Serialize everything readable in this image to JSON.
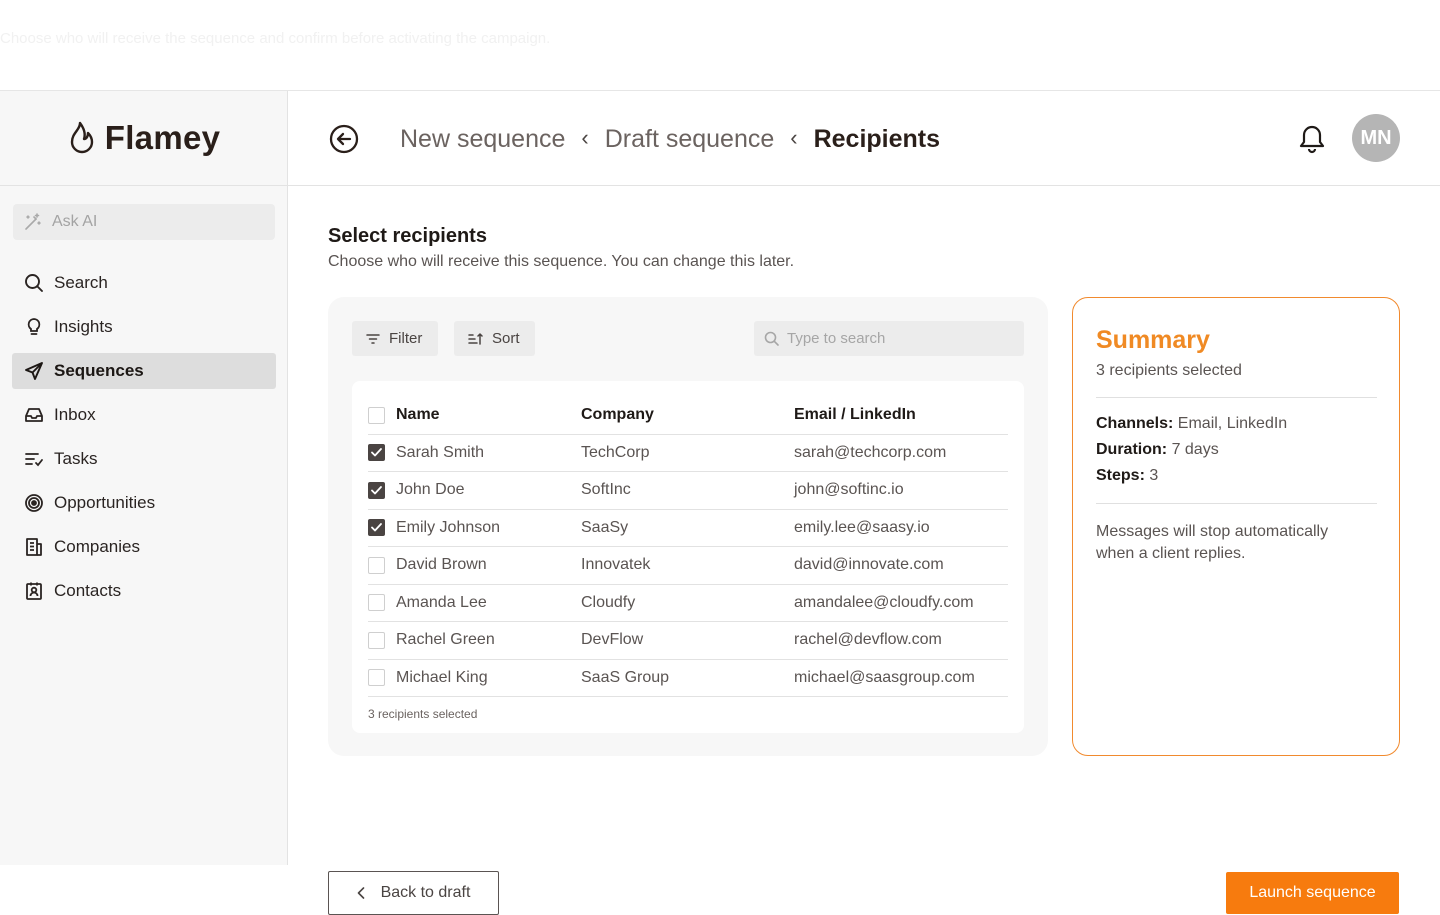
{
  "ghost_hint": "Choose who will receive the sequence and confirm before activating the campaign.",
  "brand": {
    "name": "Flamey",
    "icon": "flame-icon"
  },
  "sidebar": {
    "ask_ai": "Ask AI",
    "items": [
      {
        "label": "Search",
        "icon": "search-icon",
        "active": false
      },
      {
        "label": "Insights",
        "icon": "lightbulb-icon",
        "active": false
      },
      {
        "label": "Sequences",
        "icon": "send-icon",
        "active": true
      },
      {
        "label": "Inbox",
        "icon": "inbox-icon",
        "active": false
      },
      {
        "label": "Tasks",
        "icon": "tasks-icon",
        "active": false
      },
      {
        "label": "Opportunities",
        "icon": "target-icon",
        "active": false
      },
      {
        "label": "Companies",
        "icon": "building-icon",
        "active": false
      },
      {
        "label": "Contacts",
        "icon": "contact-card-icon",
        "active": false
      }
    ]
  },
  "header": {
    "breadcrumbs": [
      "New sequence",
      "Draft sequence",
      "Recipients"
    ],
    "separator": "‹",
    "avatar_initials": "MN"
  },
  "main": {
    "title": "Select recipients",
    "subtitle": "Choose who will receive this sequence. You can change this later.",
    "toolbar": {
      "filter_label": "Filter",
      "sort_label": "Sort",
      "search_placeholder": "Type to search",
      "search_value": ""
    },
    "table": {
      "columns": [
        "Name",
        "Company",
        "Email / LinkedIn"
      ],
      "rows": [
        {
          "name": "Sarah Smith",
          "company": "TechCorp",
          "email": "sarah@techcorp.com",
          "checked": true
        },
        {
          "name": "John Doe",
          "company": "SoftInc",
          "email": "john@softinc.io",
          "checked": true
        },
        {
          "name": "Emily Johnson",
          "company": "SaaSy",
          "email": "emily.lee@saasy.io",
          "checked": true
        },
        {
          "name": "David Brown",
          "company": "Innovatek",
          "email": "david@innovate.com",
          "checked": false
        },
        {
          "name": "Amanda Lee",
          "company": "Cloudfy",
          "email": "amandalee@cloudfy.com",
          "checked": false
        },
        {
          "name": "Rachel Green",
          "company": "DevFlow",
          "email": "rachel@devflow.com",
          "checked": false
        },
        {
          "name": "Michael King",
          "company": "SaaS Group",
          "email": "michael@saasgroup.com",
          "checked": false
        }
      ],
      "footer": "3 recipients selected"
    }
  },
  "summary": {
    "title": "Summary",
    "count": "3 recipients selected",
    "channels_label": "Channels:",
    "channels_value": "Email, LinkedIn",
    "duration_label": "Duration:",
    "duration_value": "7 days",
    "steps_label": "Steps:",
    "steps_value": "3",
    "note": "Messages will stop automatically when a client replies."
  },
  "actions": {
    "back_label": "Back to draft",
    "launch_label": "Launch sequence"
  },
  "colors": {
    "accent": "#f77b0e",
    "summary_title": "#f08a24",
    "summary_border": "#f18a2e",
    "sidebar_active": "#dddddd",
    "avatar_bg": "#b5b5b5"
  }
}
